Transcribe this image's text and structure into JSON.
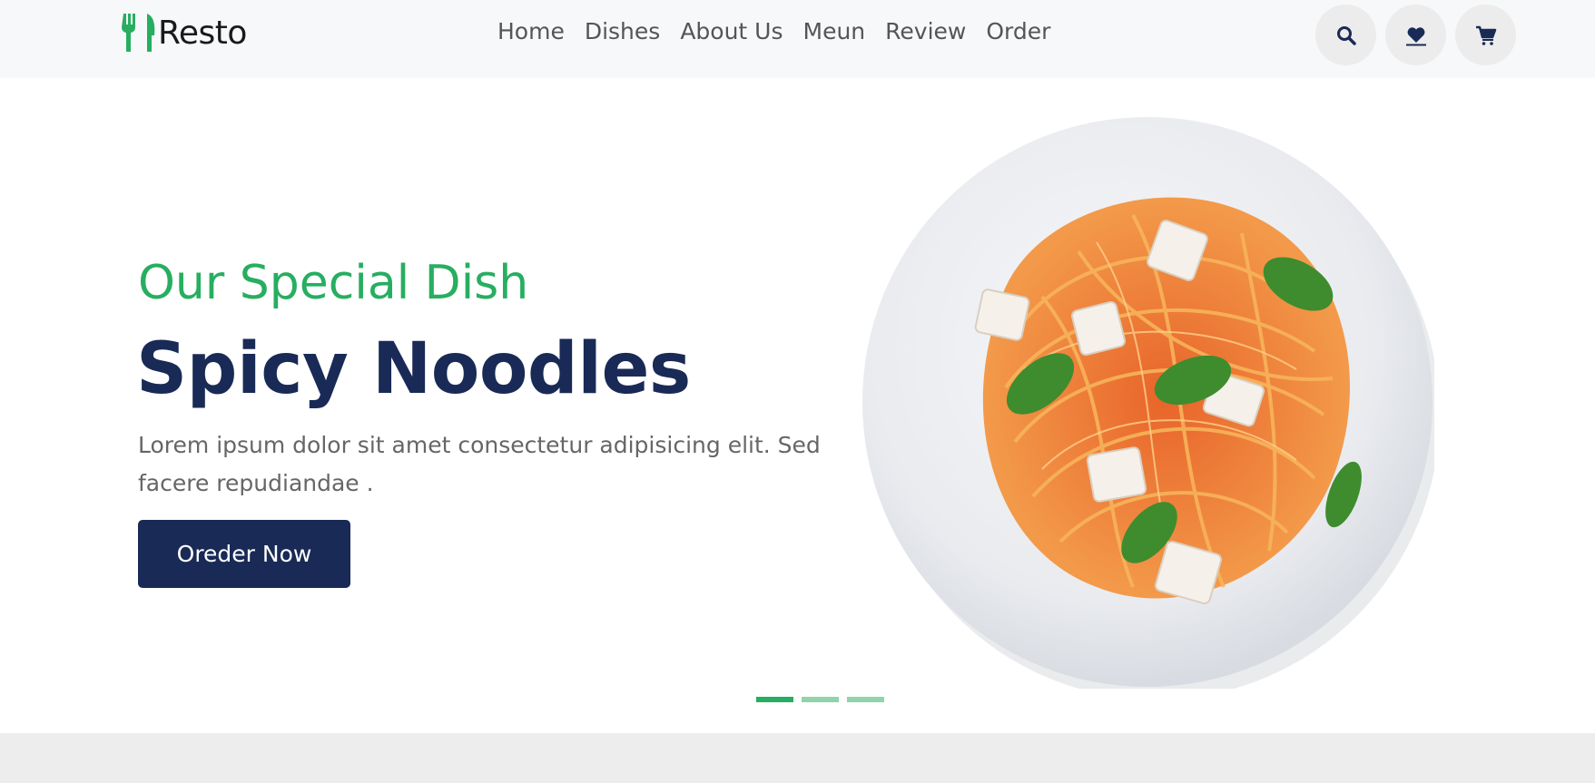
{
  "brand": {
    "name": "Resto",
    "accent": "#27ae60",
    "dark": "#192a56"
  },
  "nav": [
    {
      "label": "Home"
    },
    {
      "label": "Dishes"
    },
    {
      "label": "About Us"
    },
    {
      "label": "Meun"
    },
    {
      "label": "Review"
    },
    {
      "label": "Order"
    }
  ],
  "header_icons": [
    "search-icon",
    "heart-icon",
    "cart-icon"
  ],
  "hero": {
    "subtitle": "Our Special Dish",
    "title": "Spicy Noodles",
    "description": "Lorem ipsum dolor sit amet consectetur adipisicing elit. Sed facere repudiandae .",
    "button_label": "Oreder Now",
    "image": "spaghetti-plate-image"
  },
  "slider": {
    "total": 3,
    "active": 1
  }
}
